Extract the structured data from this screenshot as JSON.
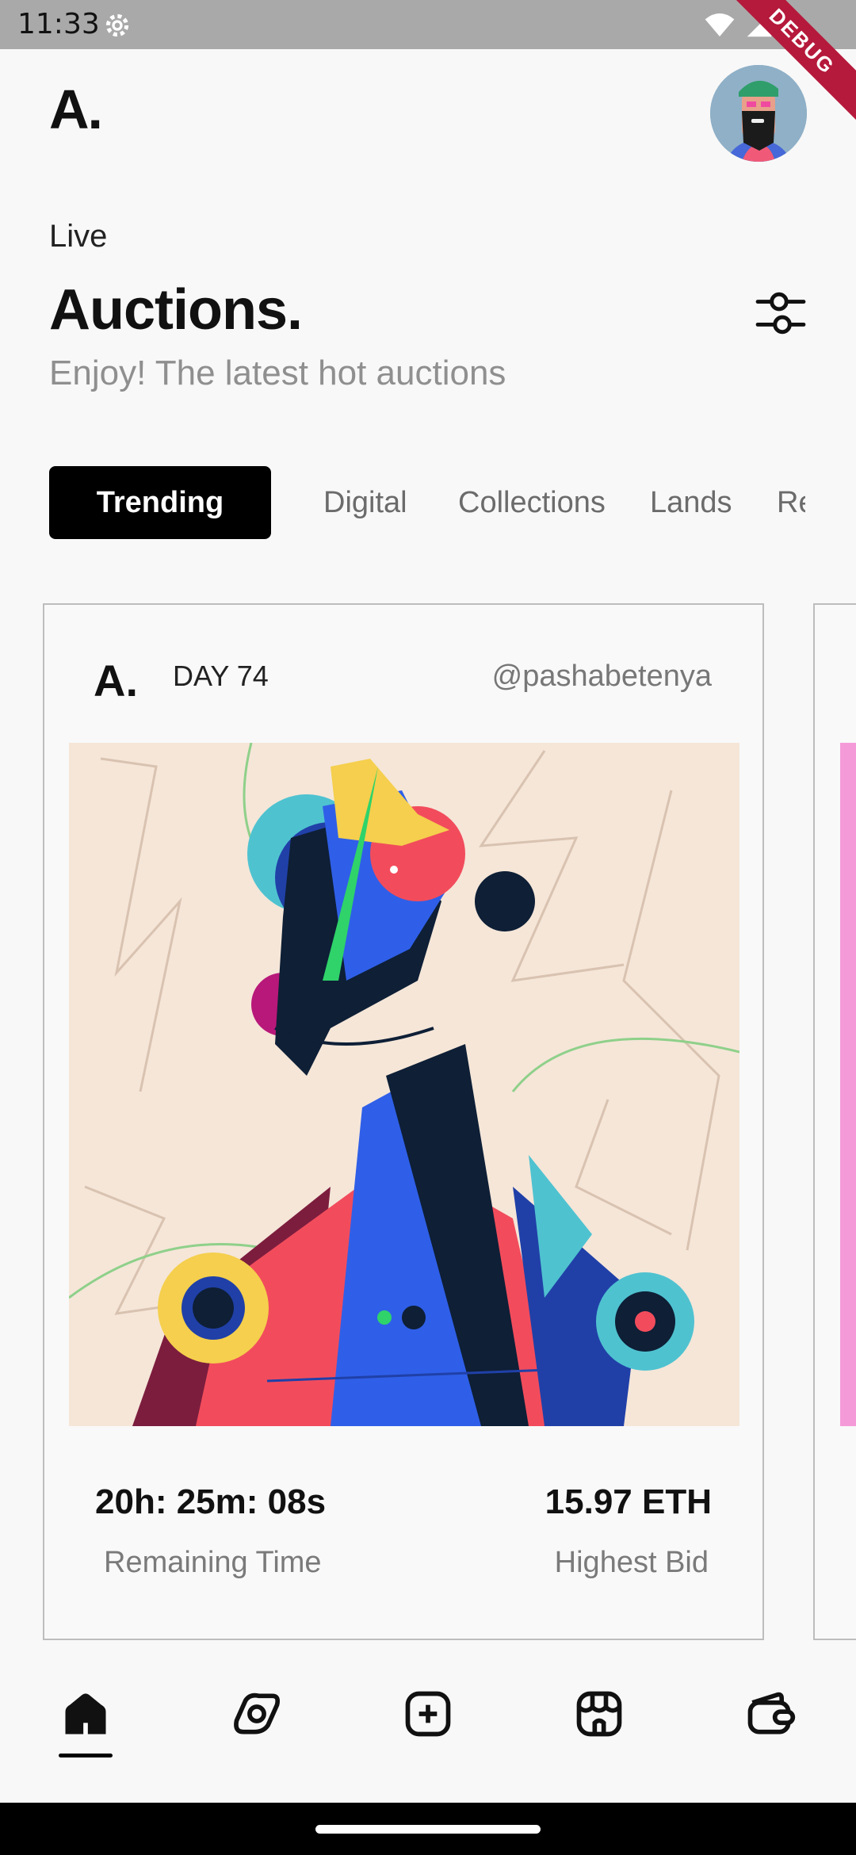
{
  "status": {
    "time": "11:33",
    "debug_label": "DEBUG"
  },
  "header": {
    "logo": "A."
  },
  "intro": {
    "live_label": "Live",
    "title": "Auctions.",
    "subtitle": "Enjoy! The latest hot auctions"
  },
  "tabs": [
    {
      "label": "Trending",
      "active": true
    },
    {
      "label": "Digital"
    },
    {
      "label": "Collections"
    },
    {
      "label": "Lands"
    },
    {
      "label": "Re"
    }
  ],
  "card": {
    "logo": "A.",
    "title": "DAY 74",
    "handle": "@pashabetenya",
    "remaining_time": "20h: 25m: 08s",
    "remaining_label": "Remaining Time",
    "highest_bid": "15.97 ETH",
    "highest_bid_label": "Highest Bid"
  },
  "nav": [
    {
      "icon": "home-icon",
      "active": true
    },
    {
      "icon": "explore-icon"
    },
    {
      "icon": "add-icon"
    },
    {
      "icon": "store-icon"
    },
    {
      "icon": "wallet-icon"
    }
  ],
  "colors": {
    "accent": "#000000",
    "subtitle": "#8f8f8f",
    "card_border": "#bdbdbd"
  }
}
